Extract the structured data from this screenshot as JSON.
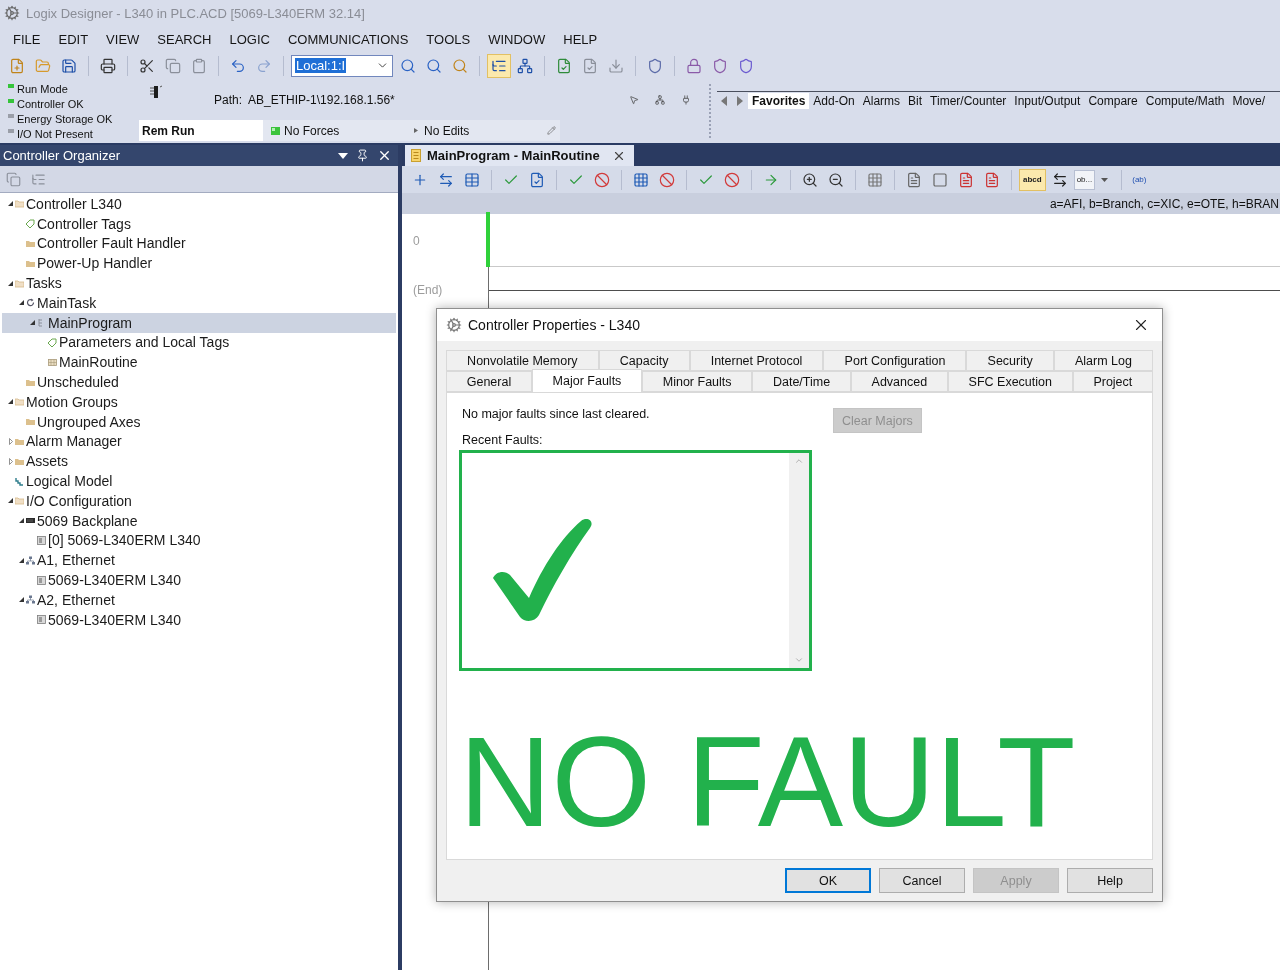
{
  "window": {
    "title": "Logix Designer - L340 in PLC.ACD [5069-L340ERM 32.14]"
  },
  "menu": [
    "FILE",
    "EDIT",
    "VIEW",
    "SEARCH",
    "LOGIC",
    "COMMUNICATIONS",
    "TOOLS",
    "WINDOW",
    "HELP"
  ],
  "toolbar": {
    "combo": {
      "value": "Local:1:I",
      "text_selected": true
    },
    "view_toggles": [
      {
        "selected": true
      },
      {
        "selected": false
      }
    ]
  },
  "controller_status": [
    {
      "label": "Run Mode",
      "on": true
    },
    {
      "label": "Controller OK",
      "on": true
    },
    {
      "label": "Energy Storage OK",
      "on": false
    },
    {
      "label": "I/O Not Present",
      "on": false
    }
  ],
  "path": {
    "label": "Path:",
    "value": "AB_ETHIP-1\\192.168.1.56*"
  },
  "status_fields": [
    {
      "kind": "mode",
      "text": "Rem Run"
    },
    {
      "kind": "forces",
      "text": "No Forces"
    },
    {
      "kind": "edits",
      "text": "No Edits"
    }
  ],
  "instruction_palette": {
    "tabs": [
      {
        "label": "Favorites",
        "selected": true
      },
      {
        "label": "Add-On",
        "selected": false
      },
      {
        "label": "Alarms",
        "selected": false
      },
      {
        "label": "Bit",
        "selected": false
      },
      {
        "label": "Timer/Counter",
        "selected": false
      },
      {
        "label": "Input/Output",
        "selected": false
      },
      {
        "label": "Compare",
        "selected": false
      },
      {
        "label": "Compute/Math",
        "selected": false
      },
      {
        "label": "Move/",
        "selected": false
      }
    ]
  },
  "organizer": {
    "title": "Controller Organizer",
    "tree": [
      {
        "label": "Controller L340",
        "kind": "folder",
        "expanded": true,
        "selected": false,
        "children": [
          {
            "label": "Controller Tags",
            "kind": "tag",
            "selected": false
          },
          {
            "label": "Controller Fault Handler",
            "kind": "folder",
            "selected": false
          },
          {
            "label": "Power-Up Handler",
            "kind": "folder",
            "selected": false
          }
        ]
      },
      {
        "label": "Tasks",
        "kind": "folder",
        "expanded": true,
        "selected": false,
        "children": [
          {
            "label": "MainTask",
            "kind": "task",
            "expanded": true,
            "selected": false,
            "children": [
              {
                "label": "MainProgram",
                "kind": "program",
                "expanded": true,
                "selected": true,
                "children": [
                  {
                    "label": "Parameters and Local Tags",
                    "kind": "tag",
                    "selected": false
                  },
                  {
                    "label": "MainRoutine",
                    "kind": "routine",
                    "selected": false
                  }
                ]
              }
            ]
          },
          {
            "label": "Unscheduled",
            "kind": "folder",
            "selected": false
          }
        ]
      },
      {
        "label": "Motion Groups",
        "kind": "folder",
        "expanded": true,
        "selected": false,
        "children": [
          {
            "label": "Ungrouped Axes",
            "kind": "folder",
            "selected": false
          }
        ]
      },
      {
        "label": "Alarm Manager",
        "kind": "folder",
        "expanded": false,
        "selected": false
      },
      {
        "label": "Assets",
        "kind": "folder",
        "expanded": false,
        "selected": false
      },
      {
        "label": "Logical Model",
        "kind": "model",
        "selected": false
      },
      {
        "label": "I/O Configuration",
        "kind": "folder",
        "expanded": true,
        "selected": false,
        "children": [
          {
            "label": "5069 Backplane",
            "kind": "backplane",
            "expanded": true,
            "selected": false,
            "children": [
              {
                "label": "[0] 5069-L340ERM L340",
                "kind": "module",
                "selected": false
              }
            ]
          },
          {
            "label": "A1, Ethernet",
            "kind": "network",
            "expanded": true,
            "selected": false,
            "children": [
              {
                "label": "5069-L340ERM L340",
                "kind": "module",
                "selected": false
              }
            ]
          },
          {
            "label": "A2, Ethernet",
            "kind": "network",
            "expanded": true,
            "selected": false,
            "children": [
              {
                "label": "5069-L340ERM L340",
                "kind": "module",
                "selected": false
              }
            ]
          }
        ]
      }
    ]
  },
  "editor": {
    "tab": {
      "title": "MainProgram - MainRoutine",
      "selected": true
    },
    "ladder_toolbar": {
      "text_toggle": {
        "label": "abcd",
        "selected": true
      },
      "format_dropdown": {
        "label": "ob..."
      },
      "tag_button": {
        "label": "(ab)"
      }
    },
    "hint": "a=AFI, b=Branch, c=XIC, e=OTE, h=BRAN",
    "rungs": [
      {
        "number": "0"
      }
    ],
    "end_label": "(End)"
  },
  "dialog": {
    "title": "Controller Properties - L340",
    "tabs": {
      "back_row": [
        {
          "label": "Nonvolatile Memory",
          "selected": false
        },
        {
          "label": "Capacity",
          "selected": false
        },
        {
          "label": "Internet Protocol",
          "selected": false
        },
        {
          "label": "Port Configuration",
          "selected": false
        },
        {
          "label": "Security",
          "selected": false
        },
        {
          "label": "Alarm Log",
          "selected": false
        }
      ],
      "front_row": [
        {
          "label": "General",
          "selected": false
        },
        {
          "label": "Major Faults",
          "selected": true
        },
        {
          "label": "Minor Faults",
          "selected": false
        },
        {
          "label": "Date/Time",
          "selected": false
        },
        {
          "label": "Advanced",
          "selected": false
        },
        {
          "label": "SFC Execution",
          "selected": false
        },
        {
          "label": "Project",
          "selected": false
        }
      ]
    },
    "message": "No major faults since last cleared.",
    "clear_button": {
      "label": "Clear Majors",
      "disabled": true
    },
    "recent_faults": {
      "label": "Recent Faults:",
      "highlighted": true
    },
    "banner": "NO FAULT",
    "buttons": [
      {
        "label": "OK",
        "default": true,
        "disabled": false
      },
      {
        "label": "Cancel",
        "default": false,
        "disabled": false
      },
      {
        "label": "Apply",
        "default": false,
        "disabled": true
      },
      {
        "label": "Help",
        "default": false,
        "disabled": false
      }
    ]
  }
}
